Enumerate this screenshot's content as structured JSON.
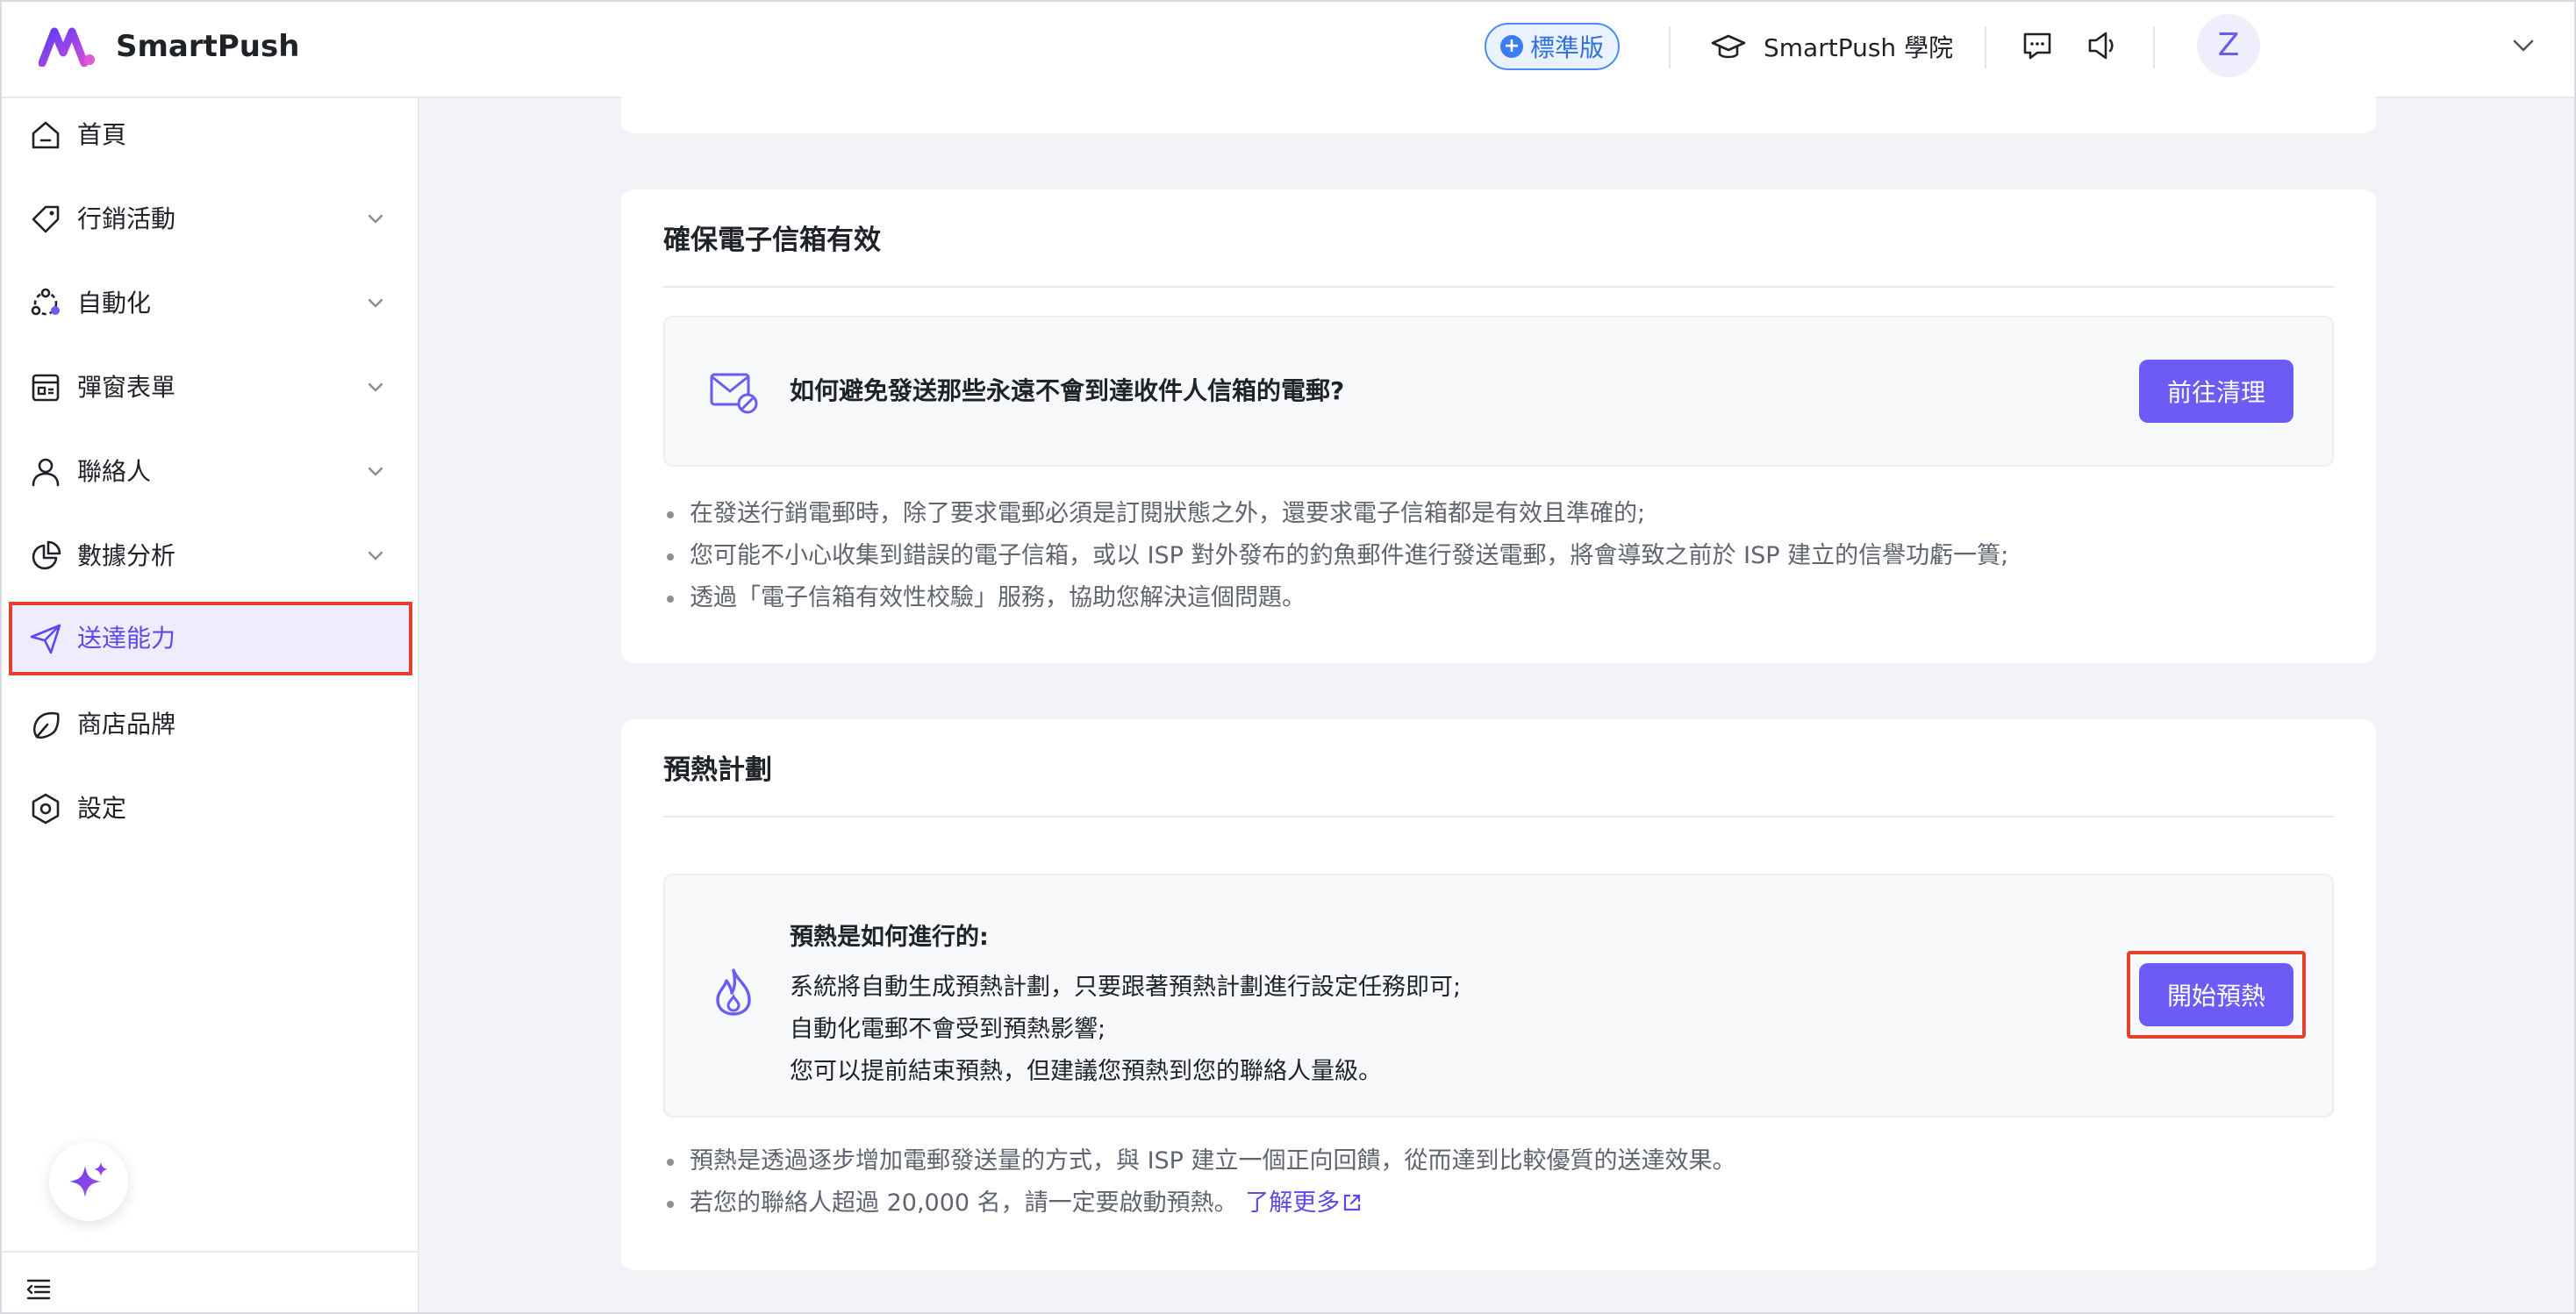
{
  "header": {
    "brand": "SmartPush",
    "plan_badge": "標準版",
    "academy_label": "SmartPush 學院",
    "avatar_initial": "Z"
  },
  "sidebar": {
    "items": [
      {
        "label": "首頁",
        "icon": "home-icon"
      },
      {
        "label": "行銷活動",
        "icon": "tag-icon"
      },
      {
        "label": "自動化",
        "icon": "automation-icon"
      },
      {
        "label": "彈窗表單",
        "icon": "form-icon"
      },
      {
        "label": "聯絡人",
        "icon": "user-icon"
      },
      {
        "label": "數據分析",
        "icon": "pie-chart-icon"
      },
      {
        "label": "送達能力",
        "icon": "send-icon",
        "active": true
      },
      {
        "label": "商店品牌",
        "icon": "brand-icon"
      },
      {
        "label": "設定",
        "icon": "settings-icon"
      }
    ]
  },
  "email_validity": {
    "title": "確保電子信箱有效",
    "question": "如何避免發送那些永遠不會到達收件人信箱的電郵?",
    "button": "前往清理",
    "bullets": [
      "在發送行銷電郵時，除了要求電郵必須是訂閱狀態之外，還要求電子信箱都是有效且準確的;",
      "您可能不小心收集到錯誤的電子信箱，或以 ISP 對外發布的釣魚郵件進行發送電郵，將會導致之前於 ISP 建立的信譽功虧一簣;",
      "透過「電子信箱有效性校驗」服務，協助您解決這個問題。"
    ]
  },
  "warmup": {
    "title": "預熱計劃",
    "heading": "預熱是如何進行的:",
    "lines": [
      "系統將自動生成預熱計劃，只要跟著預熱計劃進行設定任務即可;",
      "自動化電郵不會受到預熱影響;",
      "您可以提前結束預熱，但建議您預熱到您的聯絡人量級。"
    ],
    "button": "開始預熱",
    "bullet_1": "預熱是透過逐步增加電郵發送量的方式，與 ISP 建立一個正向回饋，從而達到比較優質的送達效果。",
    "bullet_2": "若您的聯絡人超過 20,000 名，請一定要啟動預熱。",
    "learn_more": "了解更多"
  },
  "colors": {
    "primary": "#6c5bf5",
    "active_bg": "#efedfd",
    "highlight": "#e5402e"
  }
}
